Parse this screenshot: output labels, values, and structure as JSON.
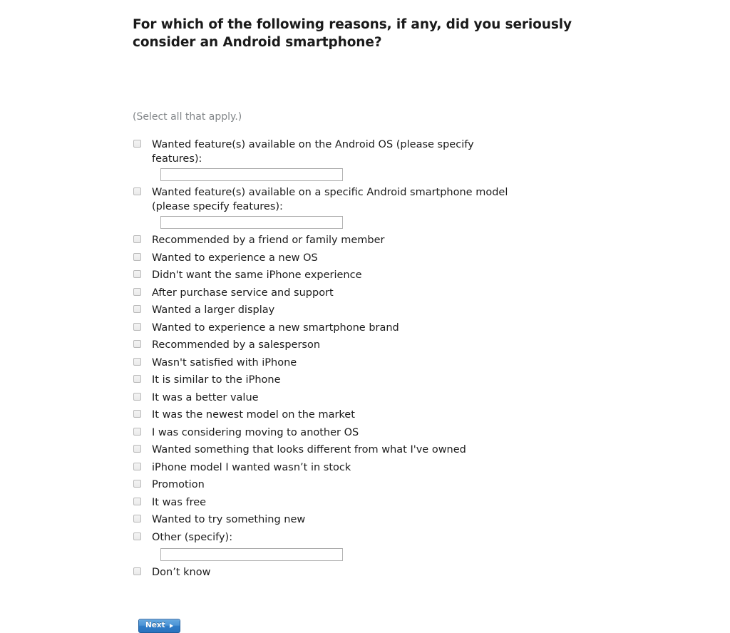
{
  "question": {
    "title": "For which of the following reasons, if any, did you seriously consider an Android smartphone?",
    "instruction": "(Select all that apply.)"
  },
  "options": [
    {
      "label": "Wanted feature(s) available on the Android OS (please specify features):",
      "wraps": true,
      "has_input": true,
      "input_value": "",
      "input_placeholder": ""
    },
    {
      "label": "Wanted feature(s) available on a specific Android smartphone model (please specify features):",
      "wraps": true,
      "has_input": true,
      "input_value": "",
      "input_placeholder": ""
    },
    {
      "label": "Recommended by a friend or family member",
      "wraps": false,
      "has_input": false
    },
    {
      "label": "Wanted to experience a new OS",
      "wraps": false,
      "has_input": false
    },
    {
      "label": "Didn't want the same iPhone experience",
      "wraps": false,
      "has_input": false
    },
    {
      "label": "After purchase service and support",
      "wraps": false,
      "has_input": false
    },
    {
      "label": "Wanted a larger display",
      "wraps": false,
      "has_input": false
    },
    {
      "label": "Wanted to experience a new smartphone brand",
      "wraps": false,
      "has_input": false
    },
    {
      "label": "Recommended by a salesperson",
      "wraps": false,
      "has_input": false
    },
    {
      "label": "Wasn't satisfied with iPhone",
      "wraps": false,
      "has_input": false
    },
    {
      "label": "It is similar to the iPhone",
      "wraps": false,
      "has_input": false
    },
    {
      "label": "It was a better value",
      "wraps": false,
      "has_input": false
    },
    {
      "label": "It was the newest model on the market",
      "wraps": false,
      "has_input": false
    },
    {
      "label": "I was considering moving to another OS",
      "wraps": false,
      "has_input": false
    },
    {
      "label": "Wanted something that looks different from what I've owned",
      "wraps": false,
      "has_input": false
    },
    {
      "label": "iPhone model I wanted wasn’t in stock",
      "wraps": false,
      "has_input": false
    },
    {
      "label": "Promotion",
      "wraps": false,
      "has_input": false
    },
    {
      "label": "It was free",
      "wraps": false,
      "has_input": false
    },
    {
      "label": "Wanted to try something new",
      "wraps": false,
      "has_input": false
    },
    {
      "label": "Other (specify):",
      "wraps": false,
      "has_input": true,
      "input_value": "",
      "input_placeholder": ""
    },
    {
      "label": "Don’t know",
      "wraps": false,
      "has_input": false
    }
  ],
  "footer": {
    "next_label": "Next",
    "next_arrow_icon": "triangle-right-icon"
  },
  "colors": {
    "page_background": "#ffffff",
    "title_text": "#1a1a1a",
    "instruction_text": "#83878a",
    "option_text": "#1c1c1c",
    "checkbox_border": "#b9b9b9",
    "input_border": "#b2b2b2",
    "button_blue": "#2f7dc8",
    "button_border": "#1d5c9e",
    "button_text": "#ffffff"
  }
}
